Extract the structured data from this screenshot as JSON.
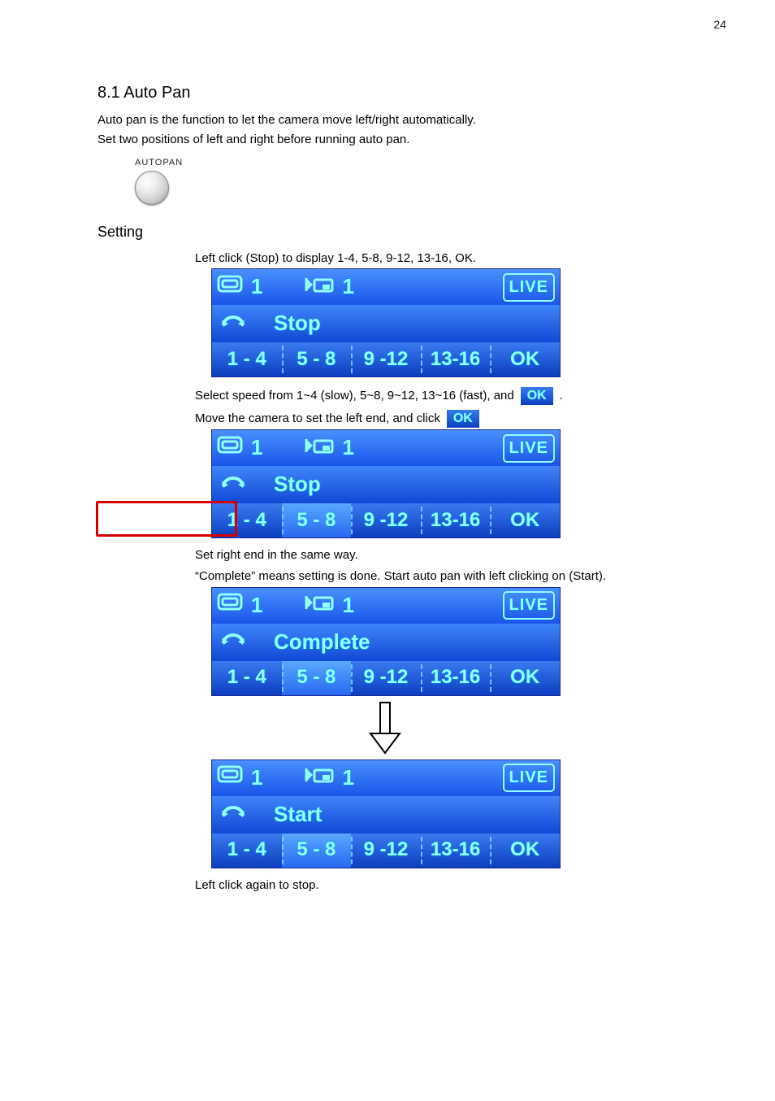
{
  "page_number": "24",
  "section": {
    "title": "8.1 Auto Pan",
    "intro1": "Auto pan is the function to let the camera move left/right automatically.",
    "intro2": "Set two positions of left and right before running auto pan."
  },
  "autopan": {
    "label": "AUTOPAN"
  },
  "setting": {
    "heading": "Setting",
    "line1": "Left click (Stop) to display 1-4, 5-8, 9-12, 13-16, OK."
  },
  "panels": {
    "p1": {
      "top": {
        "mon": "1",
        "pip": "1",
        "live": "LIVE"
      },
      "status": "Stop",
      "ranges": [
        "1 - 4",
        "5 - 8",
        "9 -12",
        "13-16"
      ],
      "ok": "OK"
    },
    "p2": {
      "top": {
        "mon": "1",
        "pip": "1",
        "live": "LIVE"
      },
      "status": "Stop",
      "ranges": [
        "1 - 4",
        "5 - 8",
        "9 -12",
        "13-16"
      ],
      "ok": "OK"
    },
    "p3": {
      "top": {
        "mon": "1",
        "pip": "1",
        "live": "LIVE"
      },
      "status": "Complete",
      "ranges": [
        "1 - 4",
        "5 - 8",
        "9 -12",
        "13-16"
      ],
      "ok": "OK"
    },
    "p4": {
      "top": {
        "mon": "1",
        "pip": "1",
        "live": "LIVE"
      },
      "status": "Start",
      "ranges": [
        "1 - 4",
        "5 - 8",
        "9 -12",
        "13-16"
      ],
      "ok": "OK"
    }
  },
  "ok_mini": "OK",
  "lines": {
    "after_p1a": "Select speed from 1~4 (slow), 5~8, 9~12, 13~16 (fast), and",
    "after_p1b": ".",
    "after_p2a": "Move the camera to set the left end, and click ",
    "after_p2b": "OK",
    "after_p2c": "Set right end in the same way.",
    "quoted": "Complete",
    "after_complete": " means setting is done. Start auto pan with left clicking on (Start).",
    "after_p4": "Left click again to stop."
  }
}
